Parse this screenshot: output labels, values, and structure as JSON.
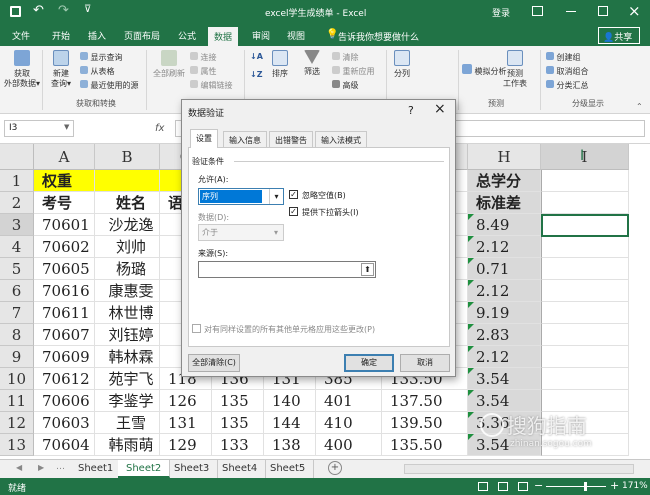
{
  "titlebar": {
    "title": "excel学生成绩单 - Excel",
    "login": "登录",
    "save_icon": "save-icon",
    "undo_icon": "undo-icon",
    "redo_icon": "redo-icon"
  },
  "tabs": [
    "文件",
    "开始",
    "插入",
    "页面布局",
    "公式",
    "数据",
    "审阅",
    "视图"
  ],
  "active_tab": "数据",
  "tellme": "告诉我你想要做什么",
  "share": "共享",
  "ribbon": {
    "get_external": "获取\n外部数据",
    "new_query": "新建\n查询",
    "show_query": "显示查询",
    "from_table": "从表格",
    "recent_sources": "最近使用的源",
    "group_transform": "获取和转换",
    "refresh_all": "全部刷新",
    "connections": "连接",
    "properties": "属性",
    "edit_links": "编辑链接",
    "sort": "排序",
    "filter": "筛选",
    "clear": "清除",
    "reapply": "重新应用",
    "advanced": "高级",
    "split": "分列",
    "whatif": "模拟分析",
    "forecast": "预测\n工作表",
    "group_forecast": "预测",
    "create_group": "创建组",
    "ungroup": "取消组合",
    "subtotal": "分类汇总",
    "group_outline": "分级显示"
  },
  "formula": {
    "namebox": "I3",
    "fx": "fx"
  },
  "columns": [
    "A",
    "B",
    "C",
    "D",
    "E",
    "F",
    "G",
    "H",
    "I"
  ],
  "rows": [
    "1",
    "2",
    "3",
    "4",
    "5",
    "6",
    "7",
    "8",
    "9",
    "10",
    "11",
    "12",
    "13"
  ],
  "cells": {
    "A1": "权重",
    "A2": "考号",
    "B2": "姓名",
    "C2": "语",
    "H1": "总学分",
    "H2": "标准差",
    "A3": "70601",
    "B3": "沙龙逸",
    "H3": "8.49",
    "A4": "70602",
    "B4": "刘帅",
    "H4": "2.12",
    "A5": "70605",
    "B5": "杨璐",
    "H5": "0.71",
    "A6": "70616",
    "B6": "康惠雯",
    "H6": "2.12",
    "A7": "70611",
    "B7": "林世博",
    "H7": "9.19",
    "A8": "70607",
    "B8": "刘钰婷",
    "H8": "2.83",
    "A9": "70609",
    "B9": "韩林霖",
    "H9": "2.12",
    "A10": "70612",
    "B10": "苑宇飞",
    "C10": "118",
    "D10": "136",
    "E10": "131",
    "F10": "385",
    "G10": "133.50",
    "H10": "3.54",
    "A11": "70606",
    "B11": "李鉴学",
    "C11": "126",
    "D11": "135",
    "E11": "140",
    "F11": "401",
    "G11": "137.50",
    "H11": "3.54",
    "A12": "70603",
    "B12": "王雪",
    "C12": "131",
    "D12": "135",
    "E12": "144",
    "F12": "410",
    "G12": "139.50",
    "H12": "3.36",
    "A13": "70604",
    "B13": "韩雨萌",
    "C13": "129",
    "D13": "133",
    "E13": "138",
    "F13": "400",
    "G13": "135.50",
    "H13": "3.54"
  },
  "sheets": [
    "Sheet1",
    "Sheet2",
    "Sheet3",
    "Sheet4",
    "Sheet5"
  ],
  "active_sheet": "Sheet2",
  "status": {
    "left": "就绪",
    "zoom": "171%"
  },
  "dialog": {
    "title": "数据验证",
    "help": "?",
    "close": "×",
    "tabs": [
      "设置",
      "输入信息",
      "出错警告",
      "输入法模式"
    ],
    "section": "验证条件",
    "allow_label": "允许(A):",
    "allow_value": "序列",
    "data_label": "数据(D):",
    "data_value": "介于",
    "ignore_blank": "忽略空值(B)",
    "dropdown": "提供下拉箭头(I)",
    "source_label": "来源(S):",
    "source_value": "",
    "apply_all": "对有同样设置的所有其他单元格应用这些更改(P)",
    "clear_all": "全部清除(C)",
    "ok": "确定",
    "cancel": "取消"
  },
  "watermark": "搜狗指南",
  "watermark_url": "zhinan.sogou.com",
  "colors": {
    "excel_green": "#217346",
    "highlight_yellow": "#ffff00",
    "header_gray": "#e6e6e6",
    "col_h_bg": "#d9d9d9"
  }
}
